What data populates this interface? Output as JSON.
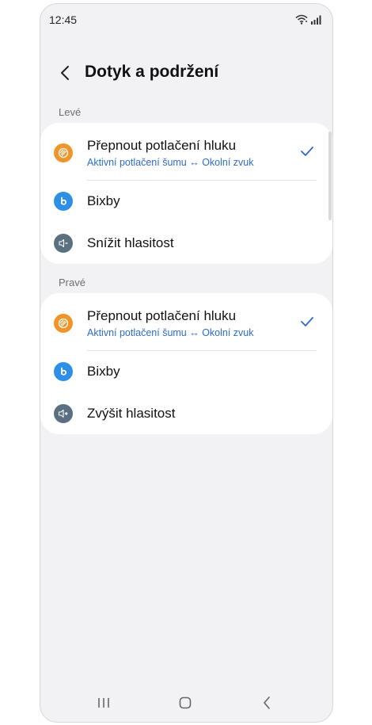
{
  "status_bar": {
    "time": "12:45",
    "icons": [
      "wifi-icon",
      "signal-icon"
    ]
  },
  "header": {
    "back_icon": "chevron-left-icon",
    "title": "Dotyk a podržení"
  },
  "sections": [
    {
      "label": "Levé",
      "items": [
        {
          "title": "Přepnout potlačení hluku",
          "subtitle": "Aktivní potlačení šumu ↔ Okolní zvuk",
          "icon": "noise-control-icon",
          "selected": true
        },
        {
          "title": "Bixby",
          "icon": "bixby-icon",
          "selected": false
        },
        {
          "title": "Snížit hlasitost",
          "icon": "volume-down-icon",
          "selected": false
        }
      ]
    },
    {
      "label": "Pravé",
      "items": [
        {
          "title": "Přepnout potlačení hluku",
          "subtitle": "Aktivní potlačení šumu ↔ Okolní zvuk",
          "icon": "noise-control-icon",
          "selected": true
        },
        {
          "title": "Bixby",
          "icon": "bixby-icon",
          "selected": false
        },
        {
          "title": "Zvýšit hlasitost",
          "icon": "volume-up-icon",
          "selected": false
        }
      ]
    }
  ],
  "nav_bar": {
    "buttons": [
      "recent-apps-icon",
      "home-icon",
      "back-icon"
    ]
  },
  "colors": {
    "accent": "#2d6ccf",
    "noise_icon": "#f0952b",
    "bixby_icon": "#2f8fe6",
    "volume_icon": "#5a7081",
    "background": "#f2f2f4"
  }
}
